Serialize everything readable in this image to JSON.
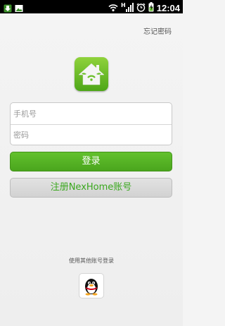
{
  "status_bar": {
    "time": "12:04",
    "icons": [
      "download-icon",
      "image-icon",
      "wifi-icon",
      "signal-h-icon",
      "alarm-clock-icon",
      "battery-charging-icon"
    ]
  },
  "header": {
    "forgot_password": "忘记密码"
  },
  "logo": {
    "icon": "home-app-logo-icon",
    "color": "#5cb624"
  },
  "form": {
    "phone_placeholder": "手机号",
    "password_placeholder": "密码"
  },
  "buttons": {
    "login_label": "登录",
    "register_label": "注册NexHome账号",
    "login_color": "#52b221",
    "register_text_color": "#3aa81e"
  },
  "other_login": {
    "label": "使用其他账号登录",
    "qq_icon": "qq-penguin-icon"
  }
}
